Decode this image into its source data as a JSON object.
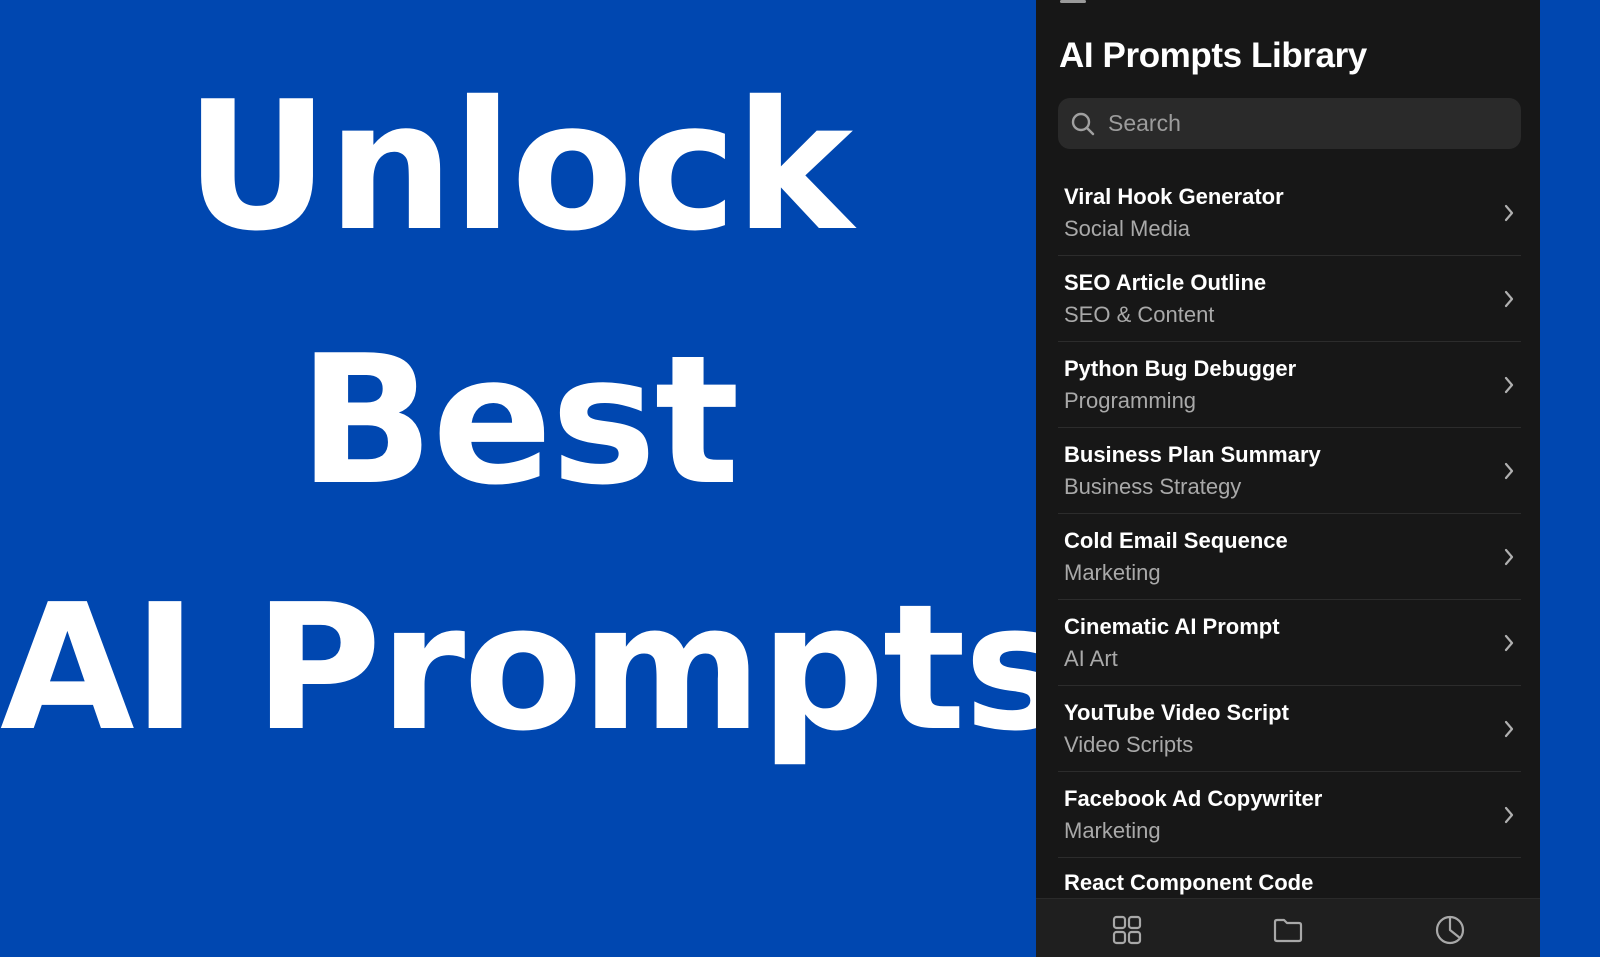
{
  "hero": {
    "line1": "Unlock",
    "line2": "Best",
    "line3": "AI Prompts"
  },
  "app": {
    "title": "AI Prompts Library",
    "search": {
      "placeholder": "Search",
      "value": ""
    },
    "prompts": [
      {
        "title": "Viral Hook Generator",
        "category": "Social Media"
      },
      {
        "title": "SEO Article Outline",
        "category": "SEO & Content"
      },
      {
        "title": "Python Bug Debugger",
        "category": "Programming"
      },
      {
        "title": "Business Plan Summary",
        "category": "Business Strategy"
      },
      {
        "title": "Cold Email Sequence",
        "category": "Marketing"
      },
      {
        "title": "Cinematic AI Prompt",
        "category": "AI Art"
      },
      {
        "title": "YouTube Video Script",
        "category": "Video Scripts"
      },
      {
        "title": "Facebook Ad Copywriter",
        "category": "Marketing"
      },
      {
        "title": "React Component Code",
        "category": ""
      }
    ],
    "tabs": [
      {
        "icon": "grid-icon"
      },
      {
        "icon": "folder-icon"
      },
      {
        "icon": "pie-chart-icon"
      }
    ]
  },
  "colors": {
    "hero_bg": "#0047b0",
    "app_bg": "#171717",
    "search_bg": "#2a2a2a",
    "text_primary": "#ffffff",
    "text_secondary": "#a9a9a9"
  }
}
